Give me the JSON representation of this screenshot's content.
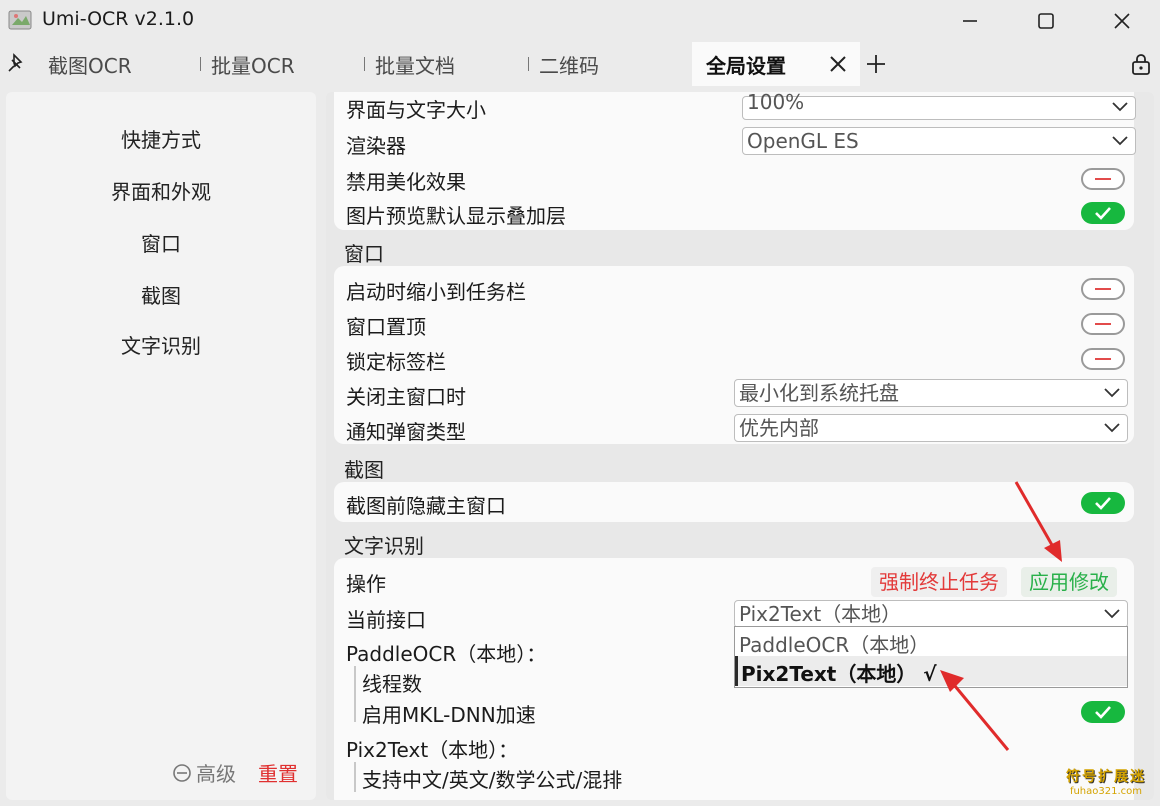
{
  "window": {
    "title": "Umi-OCR v2.1.0"
  },
  "tabs": [
    {
      "label": "截图OCR"
    },
    {
      "label": "批量OCR"
    },
    {
      "label": "批量文档"
    },
    {
      "label": "二维码"
    },
    {
      "label": "全局设置",
      "active": true
    }
  ],
  "sidebar": {
    "items": [
      {
        "label": "快捷方式"
      },
      {
        "label": "界面和外观"
      },
      {
        "label": "窗口"
      },
      {
        "label": "截图"
      },
      {
        "label": "文字识别"
      }
    ],
    "advanced_label": "高级",
    "reset_label": "重置"
  },
  "appearance": {
    "ui_scale_label": "界面与文字大小",
    "ui_scale_value": "100%",
    "renderer_label": "渲染器",
    "renderer_value": "OpenGL ES",
    "disable_effects_label": "禁用美化效果",
    "disable_effects_on": false,
    "preview_overlay_label": "图片预览默认显示叠加层",
    "preview_overlay_on": true
  },
  "window_section": {
    "title": "窗口",
    "minimize_on_start_label": "启动时缩小到任务栏",
    "minimize_on_start_on": false,
    "always_on_top_label": "窗口置顶",
    "always_on_top_on": false,
    "lock_tabbar_label": "锁定标签栏",
    "lock_tabbar_on": false,
    "on_close_label": "关闭主窗口时",
    "on_close_value": "最小化到系统托盘",
    "notify_type_label": "通知弹窗类型",
    "notify_type_value": "优先内部"
  },
  "screenshot_section": {
    "title": "截图",
    "hide_main_label": "截图前隐藏主窗口",
    "hide_main_on": true
  },
  "ocr_section": {
    "title": "文字识别",
    "action_label": "操作",
    "stop_button": "强制终止任务",
    "apply_button": "应用修改",
    "interface_label": "当前接口",
    "interface_value": "Pix2Text（本地）",
    "paddle_header": "PaddleOCR（本地）：",
    "threads_label": "线程数",
    "mkl_label": "启用MKL-DNN加速",
    "mkl_on": true,
    "pix2text_header": "Pix2Text（本地）：",
    "pix2text_desc": "支持中文/英文/数学公式/混排",
    "dropdown_options": [
      "PaddleOCR（本地）",
      "Pix2Text（本地） √"
    ]
  },
  "watermark": {
    "line1": "符号扩展迷",
    "line2": "fuhao321.com"
  },
  "colors": {
    "accent_green": "#17b83f",
    "danger_red": "#e33a3a",
    "apply_green": "#29b04a"
  }
}
